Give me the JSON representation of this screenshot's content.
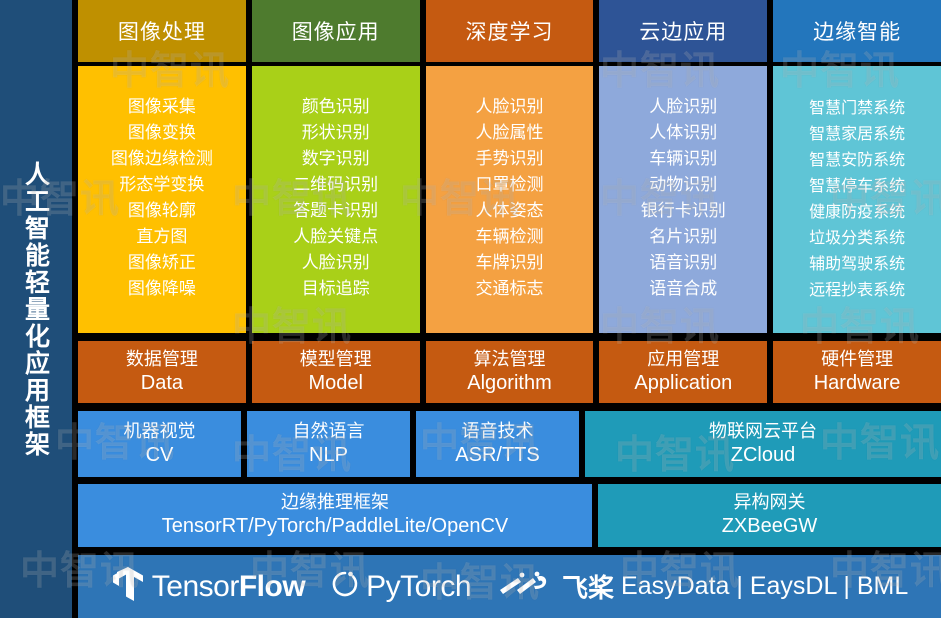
{
  "sidebar": {
    "title": "人工智能轻量化应用框架"
  },
  "watermark": {
    "text": "中智讯"
  },
  "colors": {
    "sidebar_bg": "#1F4E79",
    "page_bg": "#000000",
    "col1_head": "#BF9000",
    "col1_body": "#FFC000",
    "col2_head": "#4E7B2E",
    "col2_body": "#A9D018",
    "col3_head": "#C55A11",
    "col3_body": "#F4A142",
    "col4_head": "#2E5496",
    "col4_body": "#8EA9DB",
    "col5_head": "#2376BC",
    "col5_body": "#5FC5D6",
    "mgmt_bg": "#C55A11",
    "tech_bg": "#3A8DDE",
    "cloud_bg": "#1F9BB8",
    "framework_bg": "#3A8DDE",
    "gateway_bg": "#1F9BB8",
    "logobar_bg": "#2E75B6"
  },
  "columns": [
    {
      "head": "图像处理",
      "items": [
        "图像采集",
        "图像变换",
        "图像边缘检测",
        "形态学变换",
        "图像轮廓",
        "直方图",
        "图像矫正",
        "图像降噪"
      ]
    },
    {
      "head": "图像应用",
      "items": [
        "颜色识别",
        "形状识别",
        "数字识别",
        "二维码识别",
        "答题卡识别",
        "人脸关键点",
        "人脸识别",
        "目标追踪"
      ]
    },
    {
      "head": "深度学习",
      "items": [
        "人脸识别",
        "人脸属性",
        "手势识别",
        "口罩检测",
        "人体姿态",
        "车辆检测",
        "车牌识别",
        "交通标志"
      ]
    },
    {
      "head": "云边应用",
      "items": [
        "人脸识别",
        "人体识别",
        "车辆识别",
        "动物识别",
        "银行卡识别",
        "名片识别",
        "语音识别",
        "语音合成"
      ]
    },
    {
      "head": "边缘智能",
      "items": [
        "智慧门禁系统",
        "智慧家居系统",
        "智慧安防系统",
        "智慧停车系统",
        "健康防疫系统",
        "垃圾分类系统",
        "辅助驾驶系统",
        "远程抄表系统"
      ]
    }
  ],
  "management": [
    {
      "cn": "数据管理",
      "en": "Data"
    },
    {
      "cn": "模型管理",
      "en": "Model"
    },
    {
      "cn": "算法管理",
      "en": "Algorithm"
    },
    {
      "cn": "应用管理",
      "en": "Application"
    },
    {
      "cn": "硬件管理",
      "en": "Hardware"
    }
  ],
  "technology": [
    {
      "cn": "机器视觉",
      "en": "CV"
    },
    {
      "cn": "自然语言",
      "en": "NLP"
    },
    {
      "cn": "语音技术",
      "en": "ASR/TTS"
    },
    {
      "cn": "物联网云平台",
      "en": "ZCloud"
    }
  ],
  "framework": [
    {
      "cn": "边缘推理框架",
      "en": "TensorRT/PyTorch/PaddleLite/OpenCV"
    },
    {
      "cn": "异构网关",
      "en": "ZXBeeGW"
    }
  ],
  "logos": {
    "tensorflow": {
      "icon": "tensorflow-icon",
      "label_light": "Tensor",
      "label_bold": "Flow"
    },
    "pytorch": {
      "icon": "pytorch-icon",
      "label": "PyTorch"
    },
    "paddle": {
      "icon": "paddlepaddle-icon",
      "label_cn": "飞桨",
      "label_en": "EasyData | EaysDL | BML"
    }
  }
}
